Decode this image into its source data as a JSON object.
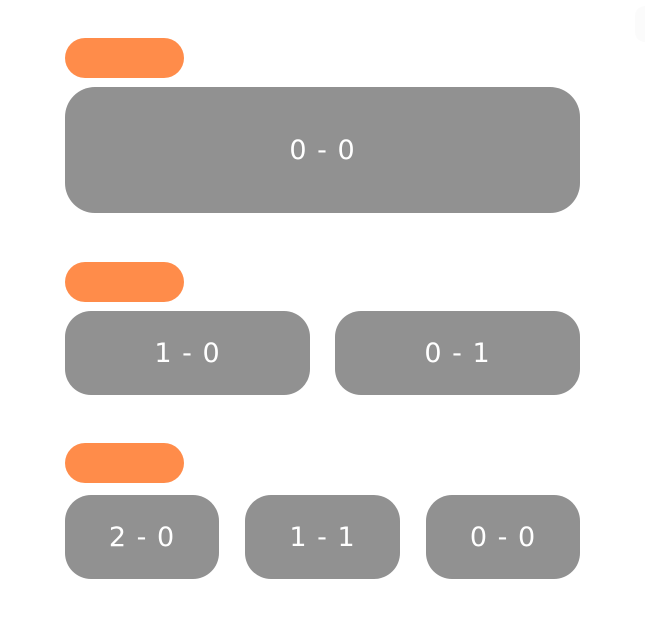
{
  "sections": [
    {
      "options": [
        "0 - 0"
      ]
    },
    {
      "options": [
        "1 - 0",
        "0 - 1"
      ]
    },
    {
      "options": [
        "2 - 0",
        "1 - 1",
        "0 - 0"
      ]
    }
  ],
  "colors": {
    "tag": "#ff8c4a",
    "button_bg": "#919191",
    "button_text": "#ffffff",
    "background": "#ffffff"
  }
}
